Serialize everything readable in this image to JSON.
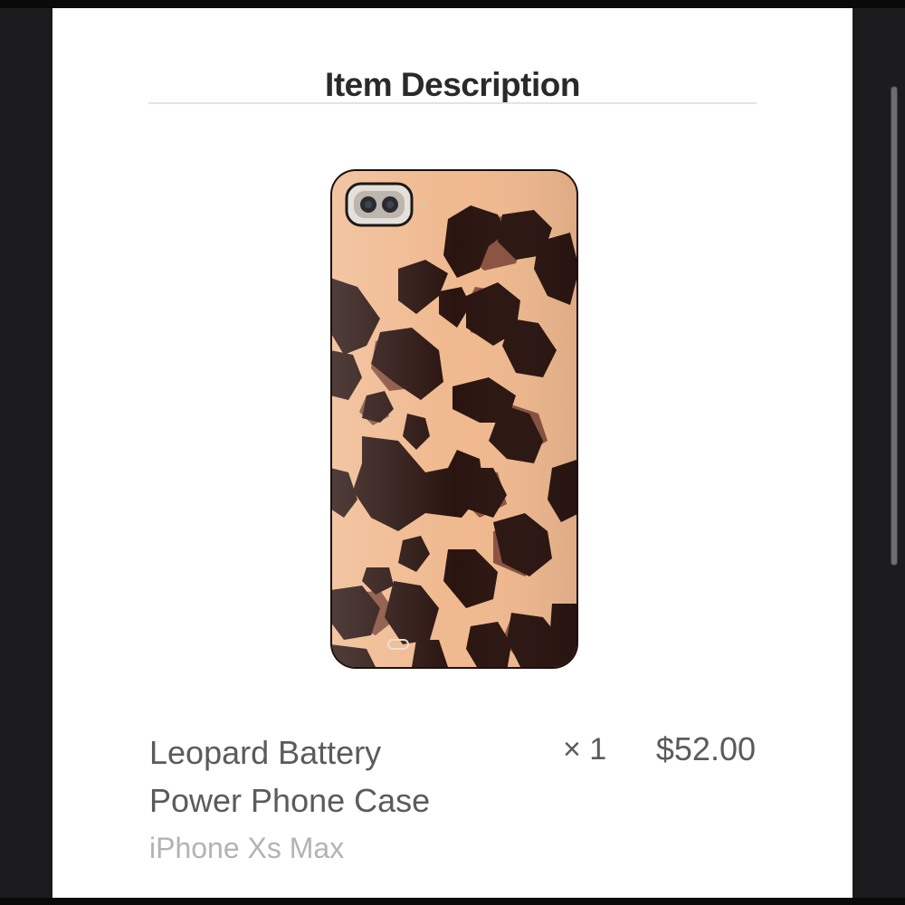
{
  "section": {
    "title": "Item Description"
  },
  "item": {
    "name_line1": "Leopard Battery",
    "name_line2": "Power Phone Case",
    "variant": "iPhone Xs Max",
    "quantity": "× 1",
    "price": "$52.00",
    "image_icon": "leopard-phone-case-image"
  },
  "colors": {
    "case_base": "#f0b98f",
    "spot_dark": "#2a1410",
    "spot_brown": "#8a5240",
    "camera_silver": "#d8d2cc"
  }
}
